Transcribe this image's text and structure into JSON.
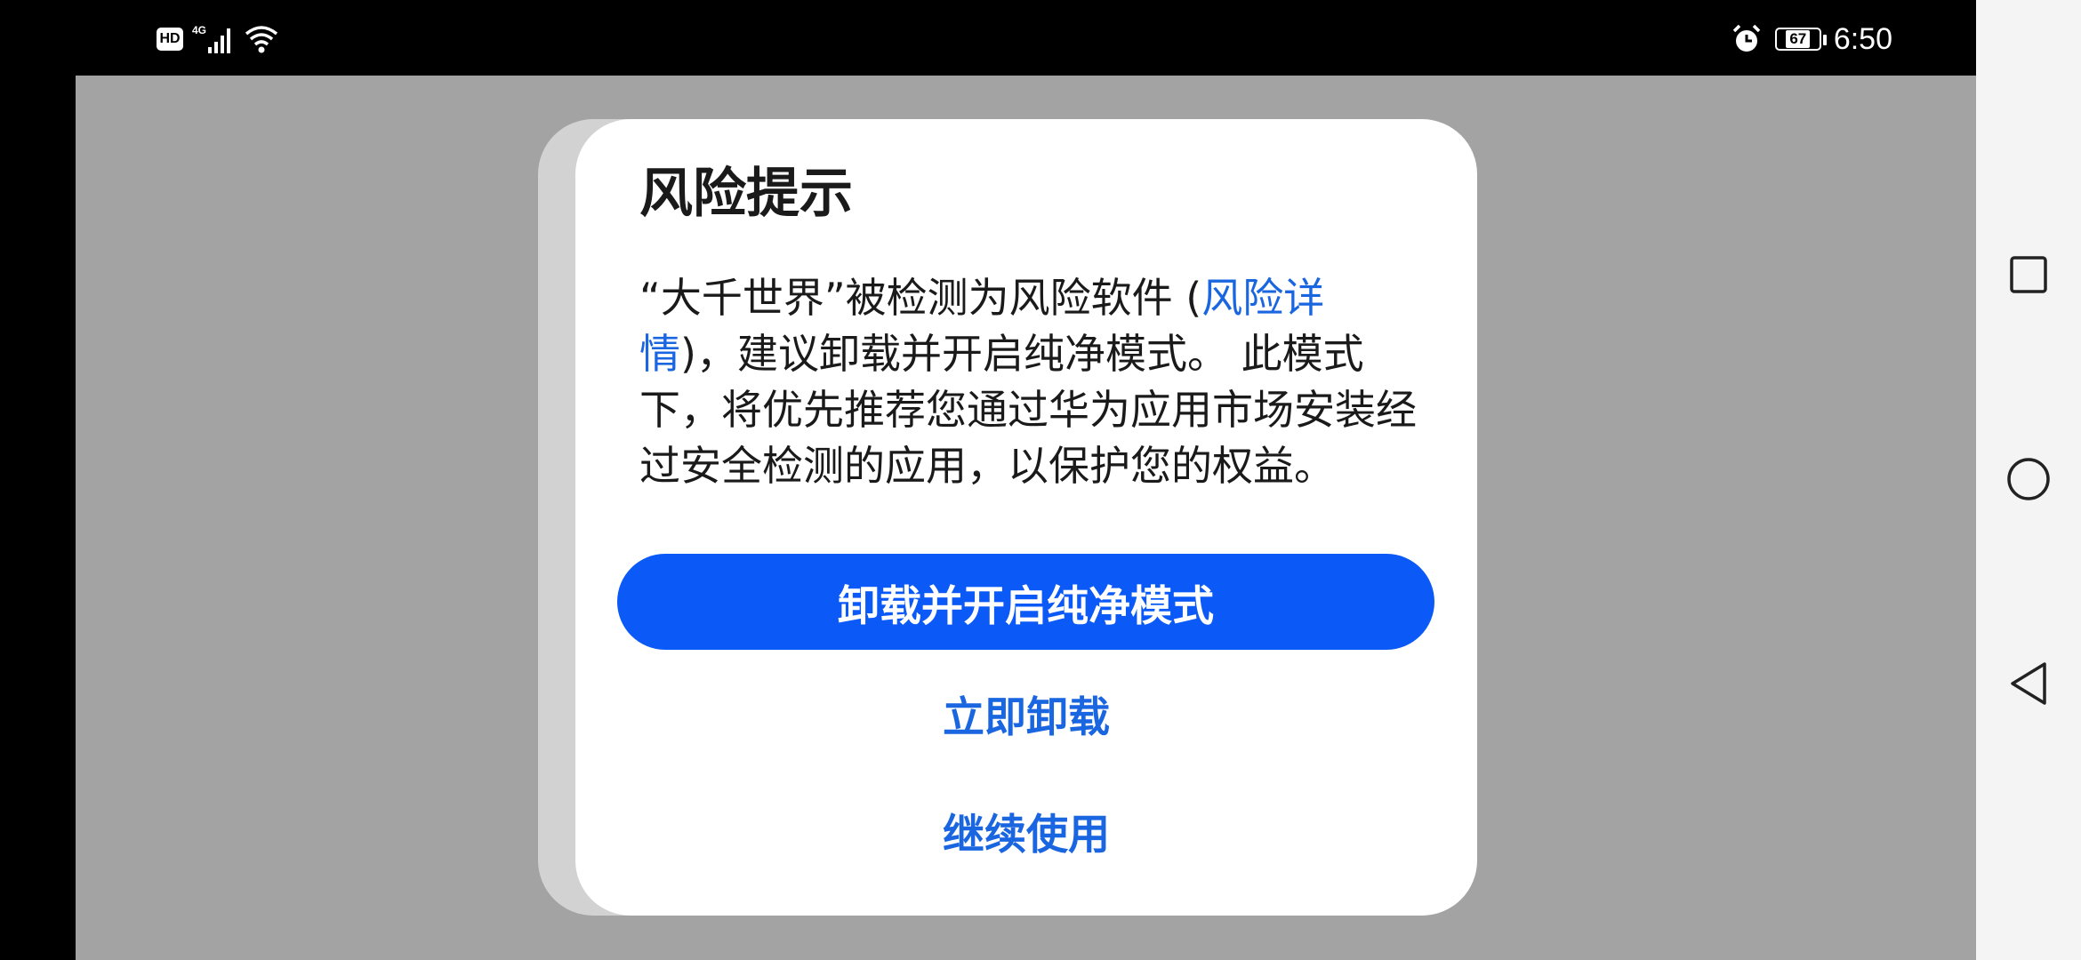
{
  "status_bar": {
    "hd_badge": "HD",
    "network": "4G",
    "battery_level": "67",
    "time": "6:50",
    "icons": [
      "hd-icon",
      "cellular-signal-icon",
      "wifi-icon",
      "alarm-icon",
      "battery-icon"
    ]
  },
  "dialog": {
    "title": "风险提示",
    "message_before_link": "“大千世界”被检测为风险软件 (",
    "message_link": "风险详情",
    "message_after_link": ")，建议卸载并开启纯净模式。 此模式下，将优先推荐您通过华为应用市场安装经过安全检测的应用，以保护您的权益。",
    "primary_button": "卸载并开启纯净模式",
    "uninstall_button": "立即卸载",
    "continue_button": "继续使用"
  },
  "nav_bar": {
    "icons": [
      "recent-apps-icon",
      "home-icon",
      "back-icon"
    ]
  },
  "colors": {
    "primary": "#0b59f6",
    "link": "#1a66e0",
    "dim_overlay": "#a3a3a3",
    "dialog_bg": "#ffffff"
  }
}
